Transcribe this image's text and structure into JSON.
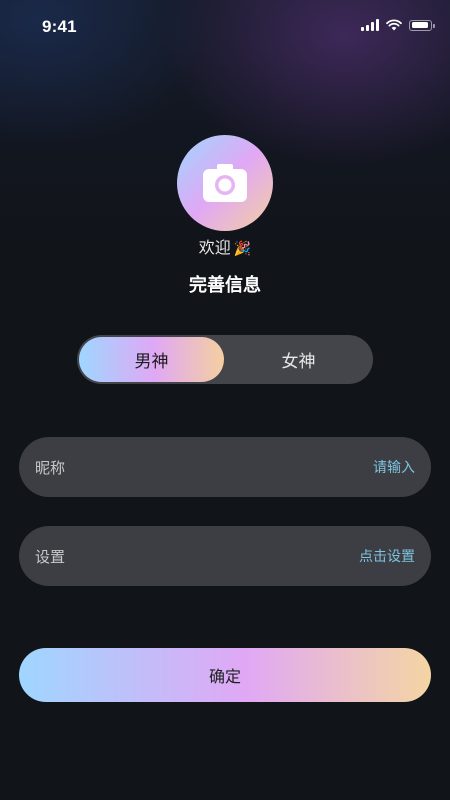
{
  "status_bar": {
    "time": "9:41",
    "battery_level": 0.9
  },
  "avatar": {
    "icon": "camera-icon"
  },
  "welcome": {
    "text": "欢迎",
    "emoji": "🎉"
  },
  "page_title": "完善信息",
  "gender": {
    "options": [
      "男神",
      "女神"
    ],
    "selected": "男神"
  },
  "form": {
    "nickname": {
      "label": "昵称",
      "placeholder": "请输入"
    },
    "setting": {
      "label": "设置",
      "action": "点击设置"
    }
  },
  "confirm_label": "确定",
  "colors": {
    "background": "#111418",
    "field_background": "#3c3e43",
    "accent_text": "#7ec3df",
    "gradient_start": "#9fd6ff",
    "gradient_mid": "#e0a8f5",
    "gradient_end": "#f4cfa0"
  }
}
